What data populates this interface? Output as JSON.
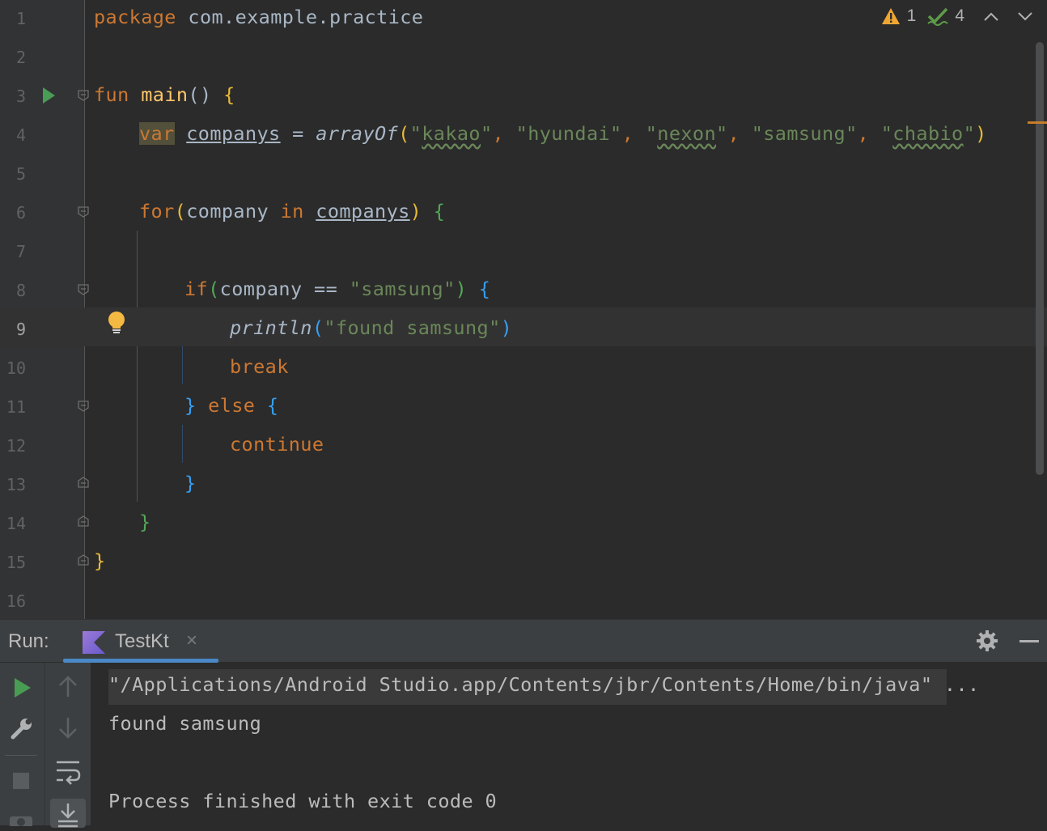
{
  "editor": {
    "line_numbers": [
      "1",
      "2",
      "3",
      "4",
      "5",
      "6",
      "7",
      "8",
      "9",
      "10",
      "11",
      "12",
      "13",
      "14",
      "15",
      "16"
    ],
    "current_line": "9",
    "code": {
      "l1_kw": "package",
      "l1_pkg": " com.example.practice",
      "l3_kw": "fun",
      "l3_fn": "main",
      "l3_rest": "() ",
      "l3_brace": "{",
      "l4_var": "var",
      "l4_name": "companys",
      "l4_eq": " = ",
      "l4_call": "arrayOf",
      "l4_open": "(",
      "l4_s1q": "\"",
      "l4_s1": "kakao",
      "l4_s1e": "\"",
      "l4_c1": ", ",
      "l4_s2": "\"hyundai\"",
      "l4_c2": ", ",
      "l4_s3q": "\"",
      "l4_s3": "nexon",
      "l4_s3e": "\"",
      "l4_c3": ", ",
      "l4_s4": "\"samsung\"",
      "l4_c4": ", ",
      "l4_s5q": "\"",
      "l4_s5": "chabio",
      "l4_s5e": "\"",
      "l4_close": ")",
      "l6_kw": "for",
      "l6_open": "(",
      "l6_var": "company ",
      "l6_in": "in",
      "l6_sp": " ",
      "l6_list": "companys",
      "l6_close": ")",
      "l6_brace": " {",
      "l8_kw": "if",
      "l8_open": "(",
      "l8_cond": "company == ",
      "l8_str": "\"samsung\"",
      "l8_close": ")",
      "l8_brace": " {",
      "l9_fn": "println",
      "l9_open": "(",
      "l9_str": "\"found samsung\"",
      "l9_close": ")",
      "l10_kw": "break",
      "l11_brace1": "}",
      "l11_else": " else ",
      "l11_brace2": "{",
      "l12_kw": "continue",
      "l13_brace": "}",
      "l14_brace": "}",
      "l15_brace": "}"
    },
    "inspections": {
      "warnings": "1",
      "checks": "4"
    }
  },
  "run_panel": {
    "label": "Run:",
    "tab_label": "TestKt",
    "console": {
      "command": "\"/Applications/Android Studio.app/Contents/jbr/Contents/Home/bin/java\" ...",
      "output": "found samsung",
      "exit": "Process finished with exit code 0"
    }
  },
  "colors": {
    "background": "#2b2b2b",
    "keyword": "#cc7832",
    "string": "#6a8759",
    "function": "#ffc66d",
    "run_green": "#499c54",
    "tab_underline": "#4a88c7"
  }
}
